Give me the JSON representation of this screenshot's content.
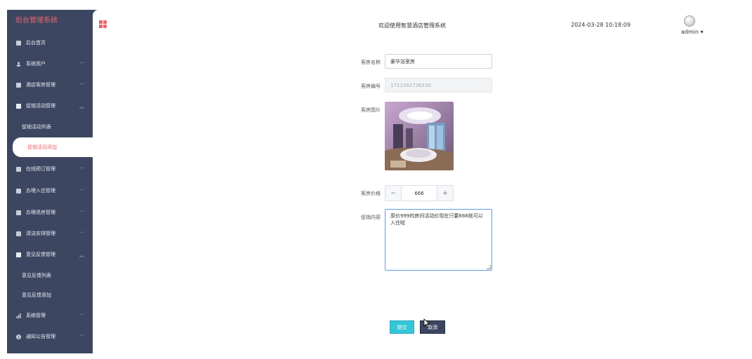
{
  "brand": "后台管理系统",
  "sidebar": {
    "items": [
      {
        "label": "后台首页",
        "icon": "monitor-icon"
      },
      {
        "label": "系统用户",
        "icon": "user-icon",
        "chevron": "﹀"
      },
      {
        "label": "酒店客房管理",
        "icon": "doc-icon",
        "chevron": "﹀"
      },
      {
        "label": "促销活动管理",
        "icon": "doc-icon",
        "chevron": "︿",
        "children": [
          {
            "label": "促销活动列表"
          },
          {
            "label": "促销活动添加",
            "active": true
          }
        ]
      },
      {
        "label": "在线预订管理",
        "icon": "doc-icon",
        "chevron": "﹀"
      },
      {
        "label": "办理入住管理",
        "icon": "doc-icon",
        "chevron": "﹀"
      },
      {
        "label": "办理退房管理",
        "icon": "doc-icon",
        "chevron": "﹀"
      },
      {
        "label": "清洁安排管理",
        "icon": "doc-icon",
        "chevron": "﹀"
      },
      {
        "label": "意见反馈管理",
        "icon": "doc-icon",
        "chevron": "︿",
        "children": [
          {
            "label": "意见反馈列表"
          },
          {
            "label": "意见反馈添加"
          }
        ]
      },
      {
        "label": "系统管理",
        "icon": "bar-chart-icon",
        "chevron": "﹀"
      },
      {
        "label": "通知公告管理",
        "icon": "info-icon",
        "chevron": "﹀"
      }
    ]
  },
  "header": {
    "welcome": "欢迎使用智慧酒店管理系统",
    "datetime": "2024-03-28 10:18:09",
    "username": "admin",
    "user_caret": "▾"
  },
  "form": {
    "room_name_label": "客房名称",
    "room_name_value": "豪华浴室房",
    "room_no_label": "客房编号",
    "room_no_value": "1711592736330",
    "room_image_label": "客房图片",
    "price_label": "客房价格",
    "price_value": "666",
    "minus": "−",
    "plus": "+",
    "promo_label": "促销内容",
    "promo_value": "原价999的房间活动价现在只要666就可以入住啦"
  },
  "buttons": {
    "submit": "提交",
    "cancel": "取消"
  },
  "colors": {
    "sidebar_bg": "#3c4660",
    "accent": "#e9656d",
    "submit_bg": "#35c6d6",
    "focus_border": "#5c9be8"
  }
}
